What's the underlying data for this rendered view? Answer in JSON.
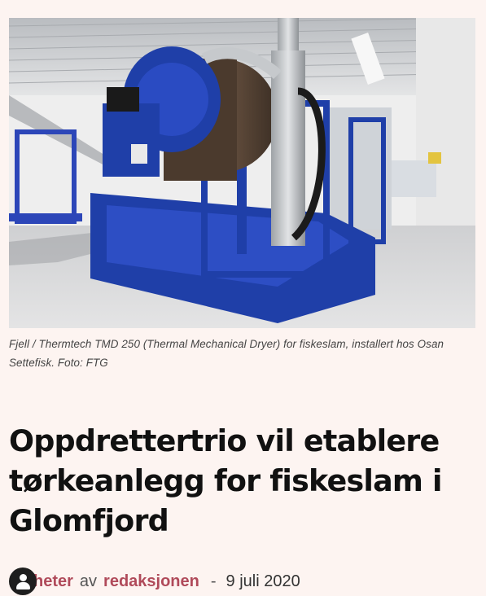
{
  "article": {
    "image_alt": "Thermtech TMD 250 dryer installed indoors",
    "caption": "Fjell / Thermtech TMD 250 (Thermal Mechanical Dryer) for fiskeslam, installert hos Osan Settefisk. Foto: FTG",
    "headline": "Oppdrettertrio vil etablere tørkeanlegg for fiskeslam i Glomfjord",
    "byline": {
      "category": "heter",
      "av": "av",
      "author": "redaksjonen",
      "separator": "-",
      "date": "9 juli 2020"
    }
  },
  "colors": {
    "background": "#fdf4f1",
    "accent": "#b04a5a",
    "machine_blue": "#1f3fa8"
  }
}
